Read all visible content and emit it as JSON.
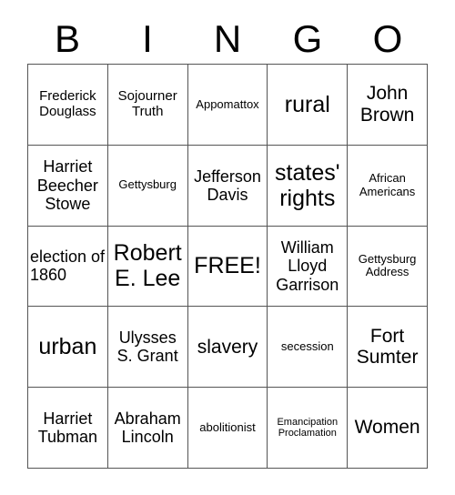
{
  "header": {
    "letters": [
      "B",
      "I",
      "N",
      "G",
      "O"
    ]
  },
  "card": {
    "columns": 5,
    "rows": 5,
    "background_color": "#ffffff",
    "text_color": "#000000",
    "border_color": "#555555",
    "cells": [
      {
        "text": "Frederick Douglass",
        "size": "m",
        "align": "center"
      },
      {
        "text": "Sojourner Truth",
        "size": "m",
        "align": "center"
      },
      {
        "text": "Appomattox",
        "size": "s",
        "align": "center"
      },
      {
        "text": "rural",
        "size": "xxl",
        "align": "center"
      },
      {
        "text": "John Brown",
        "size": "xl",
        "align": "center"
      },
      {
        "text": "Harriet Beecher Stowe",
        "size": "l",
        "align": "center"
      },
      {
        "text": "Gettysburg",
        "size": "s",
        "align": "center"
      },
      {
        "text": "Jefferson Davis",
        "size": "l",
        "align": "center"
      },
      {
        "text": "states' rights",
        "size": "xxl",
        "align": "center"
      },
      {
        "text": "African Americans",
        "size": "s",
        "align": "center"
      },
      {
        "text": "election of 1860",
        "size": "l",
        "align": "left"
      },
      {
        "text": "Robert E. Lee",
        "size": "xxl",
        "align": "center"
      },
      {
        "text": "FREE!",
        "size": "xxl",
        "align": "center"
      },
      {
        "text": "William Lloyd Garrison",
        "size": "l",
        "align": "center"
      },
      {
        "text": "Gettysburg Address",
        "size": "s",
        "align": "center"
      },
      {
        "text": "urban",
        "size": "xxl",
        "align": "center"
      },
      {
        "text": "Ulysses S. Grant",
        "size": "l",
        "align": "center"
      },
      {
        "text": "slavery",
        "size": "xl",
        "align": "center"
      },
      {
        "text": "secession",
        "size": "s",
        "align": "center"
      },
      {
        "text": "Fort Sumter",
        "size": "xl",
        "align": "center"
      },
      {
        "text": "Harriet Tubman",
        "size": "l",
        "align": "center"
      },
      {
        "text": "Abraham Lincoln",
        "size": "l",
        "align": "center"
      },
      {
        "text": "abolitionist",
        "size": "s",
        "align": "center"
      },
      {
        "text": "Emancipation Proclamation",
        "size": "xs",
        "align": "center"
      },
      {
        "text": "Women",
        "size": "xl",
        "align": "center"
      }
    ]
  }
}
